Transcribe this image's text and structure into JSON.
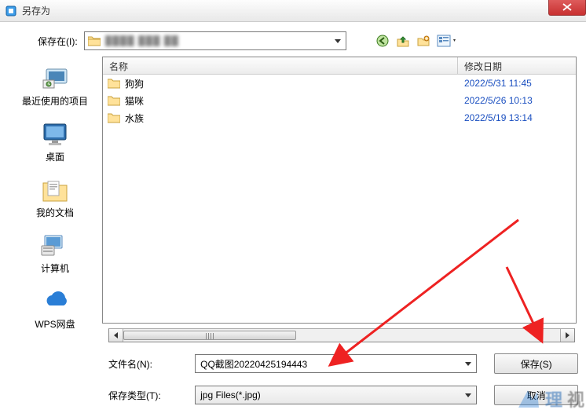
{
  "window": {
    "title": "另存为",
    "close_label": "X"
  },
  "toolbar": {
    "save_in_label": "保存在(I):",
    "path_value": "████ ███ ██",
    "nav_icons": [
      "back-icon",
      "up-icon",
      "new-folder-icon",
      "views-icon"
    ]
  },
  "sidebar": {
    "items": [
      {
        "label": "最近使用的项目",
        "icon": "recent-icon"
      },
      {
        "label": "桌面",
        "icon": "desktop-icon"
      },
      {
        "label": "我的文档",
        "icon": "documents-icon"
      },
      {
        "label": "计算机",
        "icon": "computer-icon"
      },
      {
        "label": "WPS网盘",
        "icon": "wps-cloud-icon"
      }
    ]
  },
  "file_panel": {
    "col_name": "名称",
    "col_date": "修改日期",
    "rows": [
      {
        "name": "狗狗",
        "date": "2022/5/31 11:45"
      },
      {
        "name": "猫咪",
        "date": "2022/5/26 10:13"
      },
      {
        "name": "水族",
        "date": "2022/5/19 13:14"
      }
    ]
  },
  "bottom": {
    "filename_label": "文件名(N):",
    "filename_value": "QQ截图20220425194443",
    "filetype_label": "保存类型(T):",
    "filetype_value": "jpg Files(*.jpg)",
    "save_label": "保存(S)",
    "cancel_label": "取消"
  },
  "watermark": {
    "t1": "理",
    "t2": "视"
  }
}
